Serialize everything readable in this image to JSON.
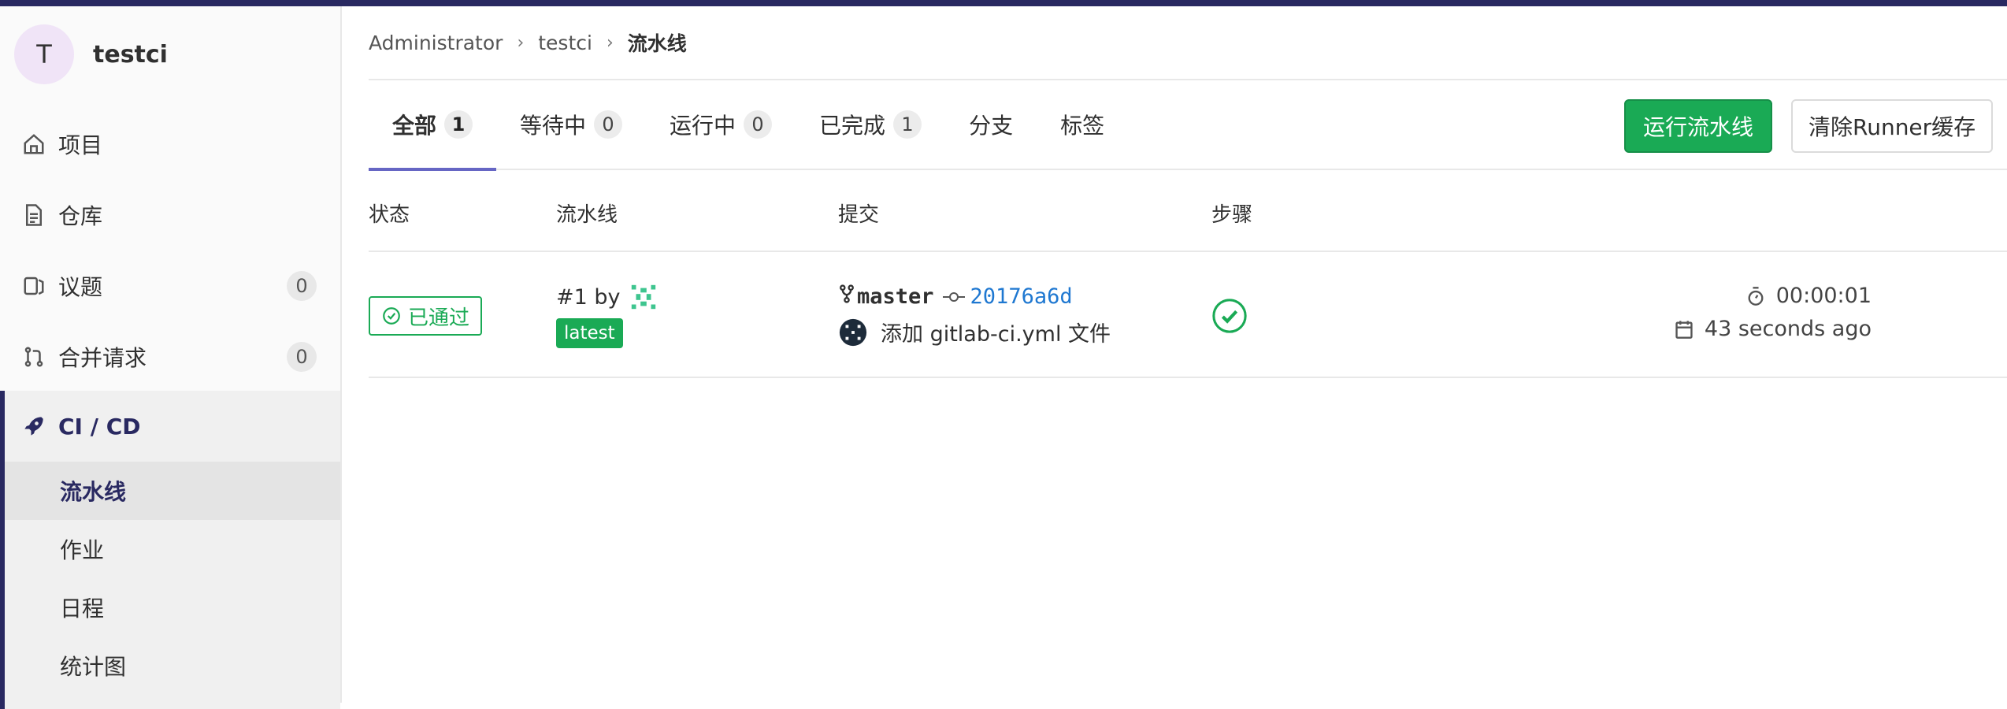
{
  "project": {
    "avatar_letter": "T",
    "name": "testci"
  },
  "sidebar": {
    "items": [
      {
        "label": "项目",
        "icon": "home-icon"
      },
      {
        "label": "仓库",
        "icon": "document-icon"
      },
      {
        "label": "议题",
        "icon": "issues-icon",
        "count": "0"
      },
      {
        "label": "合并请求",
        "icon": "merge-request-icon",
        "count": "0"
      }
    ],
    "cicd": {
      "label": "CI / CD",
      "icon": "rocket-icon",
      "sub_items": [
        {
          "label": "流水线",
          "active": true
        },
        {
          "label": "作业"
        },
        {
          "label": "日程"
        },
        {
          "label": "统计图"
        }
      ]
    }
  },
  "breadcrumb": {
    "items": [
      "Administrator",
      "testci"
    ],
    "current": "流水线"
  },
  "tabs": [
    {
      "label": "全部",
      "count": "1",
      "active": true
    },
    {
      "label": "等待中",
      "count": "0"
    },
    {
      "label": "运行中",
      "count": "0"
    },
    {
      "label": "已完成",
      "count": "1"
    },
    {
      "label": "分支"
    },
    {
      "label": "标签"
    }
  ],
  "actions": {
    "run_pipeline": "运行流水线",
    "clear_cache": "清除Runner缓存"
  },
  "table": {
    "headers": [
      "状态",
      "流水线",
      "提交",
      "步骤"
    ],
    "rows": [
      {
        "status": "已通过",
        "pipeline_id": "#1 by",
        "tag": "latest",
        "branch": "master",
        "sha": "20176a6d",
        "message": "添加 gitlab-ci.yml 文件",
        "duration": "00:00:01",
        "finished": "43 seconds ago"
      }
    ]
  },
  "colors": {
    "accent": "#292961",
    "success": "#1aaa55",
    "link": "#1f78d1"
  }
}
